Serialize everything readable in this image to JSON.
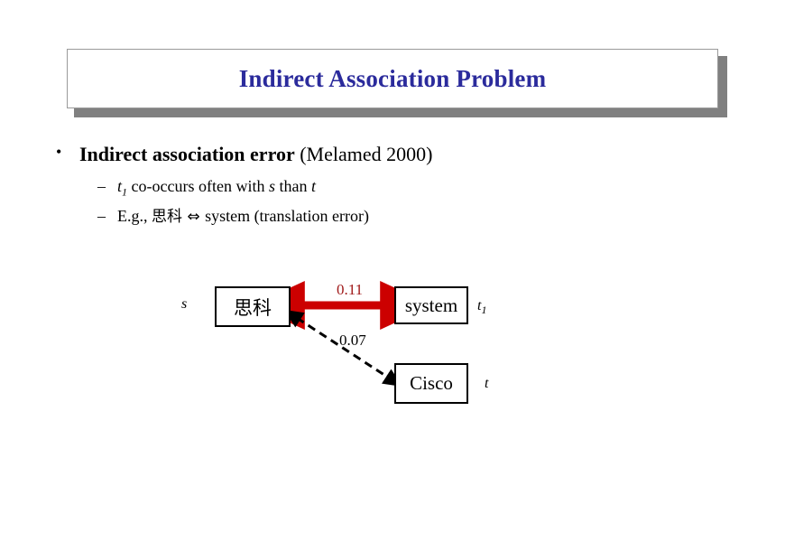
{
  "slide": {
    "title": "Indirect Association Problem",
    "title_color": "#2b2b9c"
  },
  "bullets": {
    "marker": "•",
    "level1": {
      "strong": "Indirect association error",
      "plain": " (Melamed 2000)"
    },
    "sub_marker": "–",
    "sub_items": [
      {
        "parts": [
          {
            "text": "t",
            "style": "italic"
          },
          {
            "text": "1",
            "style": "subscript"
          },
          {
            "text": " co-occurs often with ",
            "style": "plain"
          },
          {
            "text": "s",
            "style": "italic"
          },
          {
            "text": " than ",
            "style": "plain"
          },
          {
            "text": "t",
            "style": "italic"
          }
        ],
        "plain_text": "t1 co-occurs often with s than t"
      },
      {
        "parts": [
          {
            "text": "E.g., ",
            "style": "plain"
          },
          {
            "text": "思科",
            "style": "cjk"
          },
          {
            "text": " ⇔ ",
            "style": "arrow"
          },
          {
            "text": "system (translation error)",
            "style": "plain"
          }
        ],
        "plain_text": "E.g., 思科 ⇔ system (translation error)"
      }
    ]
  },
  "diagram": {
    "nodes": [
      {
        "id": "source",
        "label": "思科",
        "var_label": "s"
      },
      {
        "id": "target1",
        "label": "system",
        "var_label": "t1"
      },
      {
        "id": "target2",
        "label": "Cisco",
        "var_label": "t"
      }
    ],
    "edges": [
      {
        "id": "source-target1",
        "weight": "0.11",
        "color": "#cc0000",
        "style": "solid",
        "arrowheads": "both"
      },
      {
        "id": "source-target2",
        "weight": "0.07",
        "color": "#000000",
        "style": "dashed",
        "arrowheads": "both"
      }
    ]
  }
}
